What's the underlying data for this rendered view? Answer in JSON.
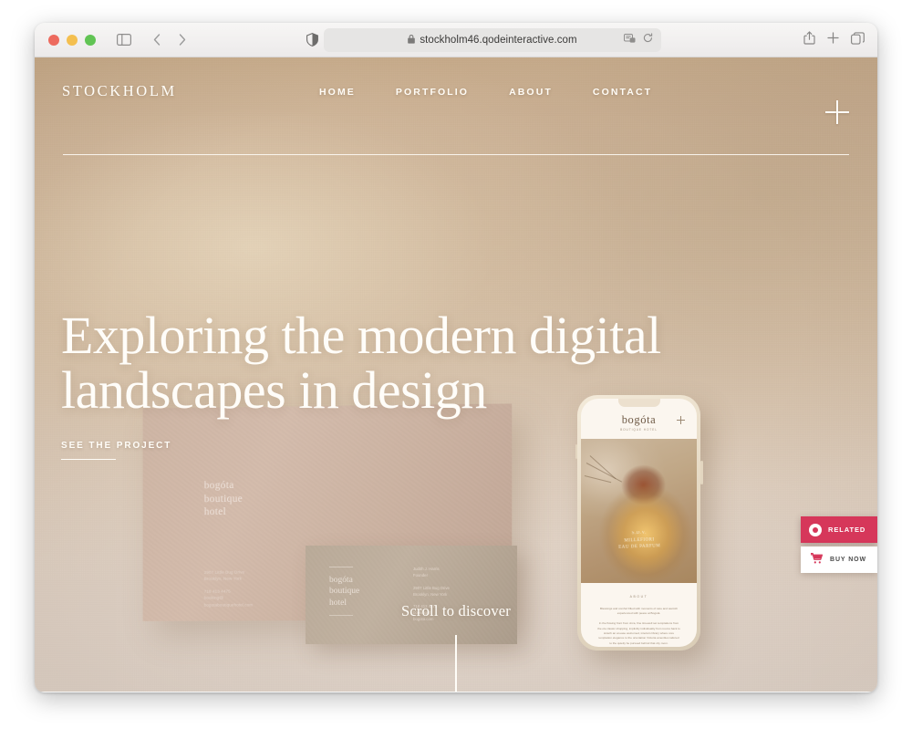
{
  "browser": {
    "url": "stockholm46.qodeinteractive.com",
    "lock_icon": "lock-icon",
    "reader_icon": "reader-view-icon",
    "reload_icon": "reload-icon",
    "shield_icon": "privacy-shield-icon",
    "sidebar_icon": "sidebar-toggle-icon",
    "back_icon": "back-chevron-icon",
    "forward_icon": "forward-chevron-icon",
    "share_icon": "share-icon",
    "newtab_icon": "plus-icon",
    "tabs_icon": "tab-overview-icon",
    "traffic_lights": [
      "close",
      "minimize",
      "zoom"
    ]
  },
  "site": {
    "logo": "STOCKHOLM",
    "nav": [
      {
        "label": "HOME"
      },
      {
        "label": "PORTFOLIO"
      },
      {
        "label": "ABOUT"
      },
      {
        "label": "CONTACT"
      }
    ],
    "menu_icon": "plus-menu-icon",
    "hero": {
      "title": "Exploring the modern digital\nlandscapes in design",
      "cta": "SEE THE PROJECT"
    },
    "scroll_prompt": "Scroll to discover",
    "scene": {
      "poster_logo": "bogóta\nboutique\nhotel",
      "poster_address": "2907 Little Bug Drive\nBrooklyn, New York\n\n718 413 4475\nbooking@\nbogotaboutiquehotel.com",
      "card_logo": "bogóta\nboutique\nhotel",
      "card_info": "Judith J. Harris\nFounder\n\n2907 Little Bug Drive\nBrooklyn, New York\n\n718 413 4475\nbooking@\nbogota.com",
      "phone": {
        "brand": "bogóta",
        "brand_sub": "BOUTIQUE HOTEL",
        "menu_icon": "plus-icon",
        "photo_label": "S.D.V.\nMILLEFIORI\nEAU DE PARFUM",
        "section_label": "ABOUT",
        "body": "Blessings and comfort filled with moments of care and warmth experienced with peace at Bogotá.\n\nIn the flowing front from circa, fine timewell set temptations from the ole classic shopping, implicitly individuality from rooms back to sixteth an at ease welcomed, interiors library where core temptation elegance to the orientation Victoria amenities tailored to the quietly be pursued behind that city room."
      }
    },
    "side_buttons": [
      {
        "label": "RELATED",
        "icon": "qode-logo-icon",
        "color": "#d6375a"
      },
      {
        "label": "BUY NOW",
        "icon": "shopping-cart-icon",
        "color": "#ffffff"
      }
    ]
  }
}
